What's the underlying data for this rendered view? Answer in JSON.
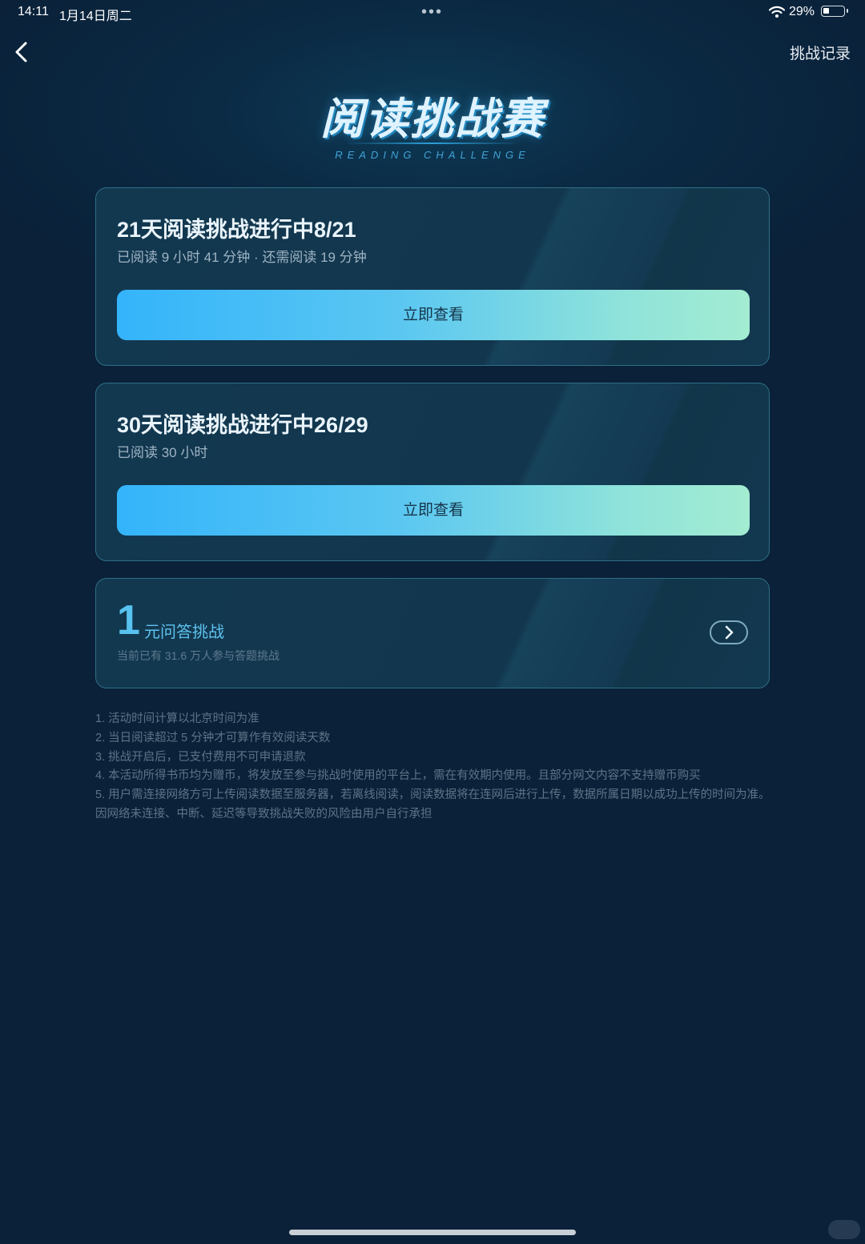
{
  "status_bar": {
    "time": "14:11",
    "date": "1月14日周二",
    "more_dots": "•••",
    "battery_percent": "29%",
    "battery_level": 0.29
  },
  "nav": {
    "records_label": "挑战记录"
  },
  "hero": {
    "title": "阅读挑战赛",
    "subtitle": "READING CHALLENGE"
  },
  "challenges": [
    {
      "title": "21天阅读挑战进行中8/21",
      "detail": "已阅读 9 小时 41 分钟 · 还需阅读 19 分钟",
      "button_label": "立即查看"
    },
    {
      "title": "30天阅读挑战进行中26/29",
      "detail": "已阅读 30 小时",
      "button_label": "立即查看"
    }
  ],
  "quiz": {
    "amount": "1",
    "title": "元问答挑战",
    "participants": "当前已有 31.6 万人参与答题挑战"
  },
  "rules": [
    "1. 活动时间计算以北京时间为准",
    "2. 当日阅读超过 5 分钟才可算作有效阅读天数",
    "3. 挑战开启后，已支付费用不可申请退款",
    "4. 本活动所得书币均为赠币，将发放至参与挑战时使用的平台上，需在有效期内使用。且部分网文内容不支持赠币购买",
    "5. 用户需连接网络方可上传阅读数据至服务器，若离线阅读，阅读数据将在连网后进行上传，数据所属日期以成功上传的时间为准。因网络未连接、中断、延迟等导致挑战失败的风险由用户自行承担"
  ],
  "colors": {
    "background": "#0a2139",
    "accent": "#34b4fb",
    "accent_end": "#a3ecd2",
    "quiz_accent": "#58c2f0"
  },
  "icons": {
    "back": "chevron-left-icon",
    "quiz_enter": "chevron-right-icon",
    "wifi": "wifi-icon",
    "battery": "battery-icon"
  }
}
